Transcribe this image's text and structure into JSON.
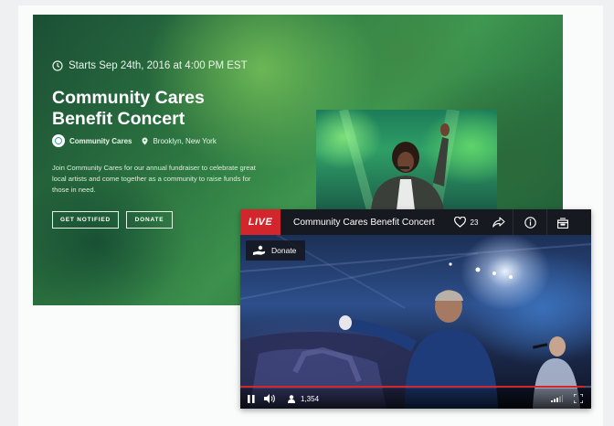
{
  "event": {
    "starts": "Starts Sep 24th, 2016 at 4:00 PM EST",
    "title_line1": "Community Cares",
    "title_line2": "Benefit Concert",
    "organizer": "Community Cares",
    "location": "Brooklyn, New York",
    "description": "Join Community Cares for our annual fundraiser to celebrate great local artists and come together as a community to raise funds for those in need.",
    "notify_label": "GET NOTIFIED",
    "donate_label": "DONATE"
  },
  "player": {
    "live_label": "LIVE",
    "title": "Community Cares Benefit Concert",
    "likes": "23",
    "donate_label": "Donate",
    "viewers": "1,354",
    "progress_fraction": 0.98,
    "accent_color": "#d3262c"
  },
  "icons": [
    "clock-icon",
    "location-pin-icon",
    "heart-icon",
    "share-icon",
    "info-icon",
    "gift-icon",
    "donate-hand-icon",
    "pause-icon",
    "volume-icon",
    "viewers-icon",
    "signal-icon",
    "fullscreen-icon"
  ]
}
